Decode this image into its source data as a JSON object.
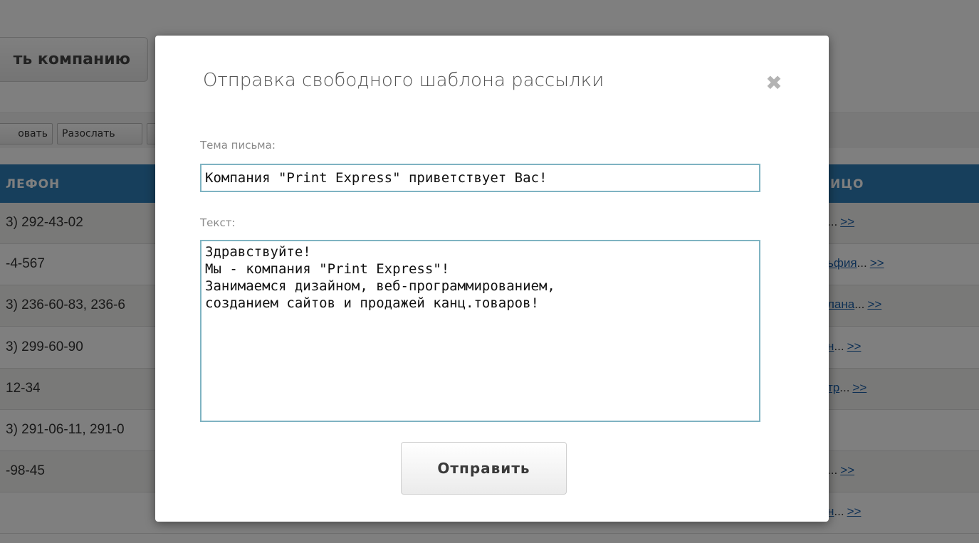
{
  "background": {
    "add_company_label": "ть компанию",
    "toolbar": {
      "btn1_label": "овать",
      "btn2_label": "Разослать",
      "btn3_label": ""
    },
    "table": {
      "headers": {
        "phone": "ЛЕФОН",
        "person": "ИЦО"
      },
      "rows": [
        {
          "phone": "3) 292-43-02",
          "person_link": "",
          "person_dots": "...",
          "more": ">>"
        },
        {
          "phone": "-4-567",
          "person_link": "ьфия",
          "person_dots": "...",
          "more": ">>"
        },
        {
          "phone": "3) 236-60-83, 236-6",
          "person_link": "лана",
          "person_dots": "...",
          "more": ">>"
        },
        {
          "phone": "3) 299-60-90",
          "person_link": "н",
          "person_dots": "...",
          "more": ">>"
        },
        {
          "phone": "12-34",
          "person_link": "тр",
          "person_dots": "...",
          "more": ">>"
        },
        {
          "phone": "3) 291-06-11, 291-0",
          "person_link": "",
          "person_dots": "",
          "more": ""
        },
        {
          "phone": "-98-45",
          "person_link": "",
          "person_dots": "...",
          "more": ">>"
        },
        {
          "phone": "",
          "person_link": "н",
          "person_dots": "...",
          "more": ">>"
        }
      ]
    }
  },
  "modal": {
    "title": "Отправка свободного шаблона рассылки",
    "close_icon": "close-icon",
    "subject_label": "Тема письма:",
    "subject_value": "Компания \"Print Express\" приветствует Вас!",
    "text_label": "Текст:",
    "text_value": "Здравствуйте!\nМы - компания \"Print Express\"!\nЗанимаемся дизайном, веб-программированием,\nсозданием сайтов и продажей канц.товаров!",
    "send_label": "Отправить"
  },
  "colors": {
    "header_blue": "#2e7fb9",
    "link_blue": "#1a5fa8",
    "input_border": "#7fb3c2",
    "overlay": "rgba(0,0,0,0.5)"
  }
}
